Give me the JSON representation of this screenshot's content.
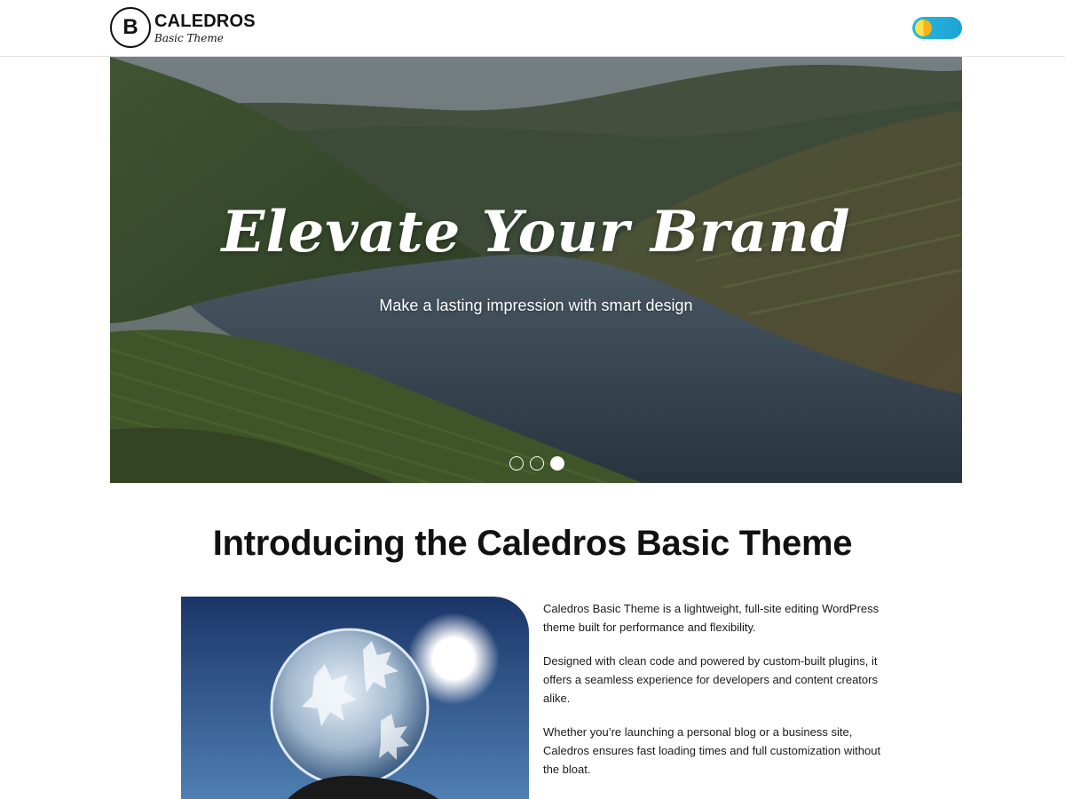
{
  "header": {
    "logo_letter": "B",
    "logo_name": "CALEDROS",
    "logo_tagline": "Basic Theme"
  },
  "hero": {
    "title": "Elevate Your Brand",
    "subtitle": "Make a lasting impression with smart design",
    "active_slide": 3,
    "slide_count": 3
  },
  "intro": {
    "title": "Introducing the Caledros Basic Theme",
    "paragraphs": [
      "Caledros Basic Theme is a lightweight, full-site editing WordPress theme built for performance and flexibility.",
      "Designed with clean code and powered by custom-built plugins, it offers a seamless experience for developers and content creators alike.",
      "Whether you’re launching a personal blog or a business site, Caledros ensures fast loading times and full customization without the bloat."
    ]
  },
  "colors": {
    "toggle_track": "#27b6e0",
    "toggle_knob_light": "#ffe04a",
    "toggle_knob_dark": "#f5b21c"
  }
}
